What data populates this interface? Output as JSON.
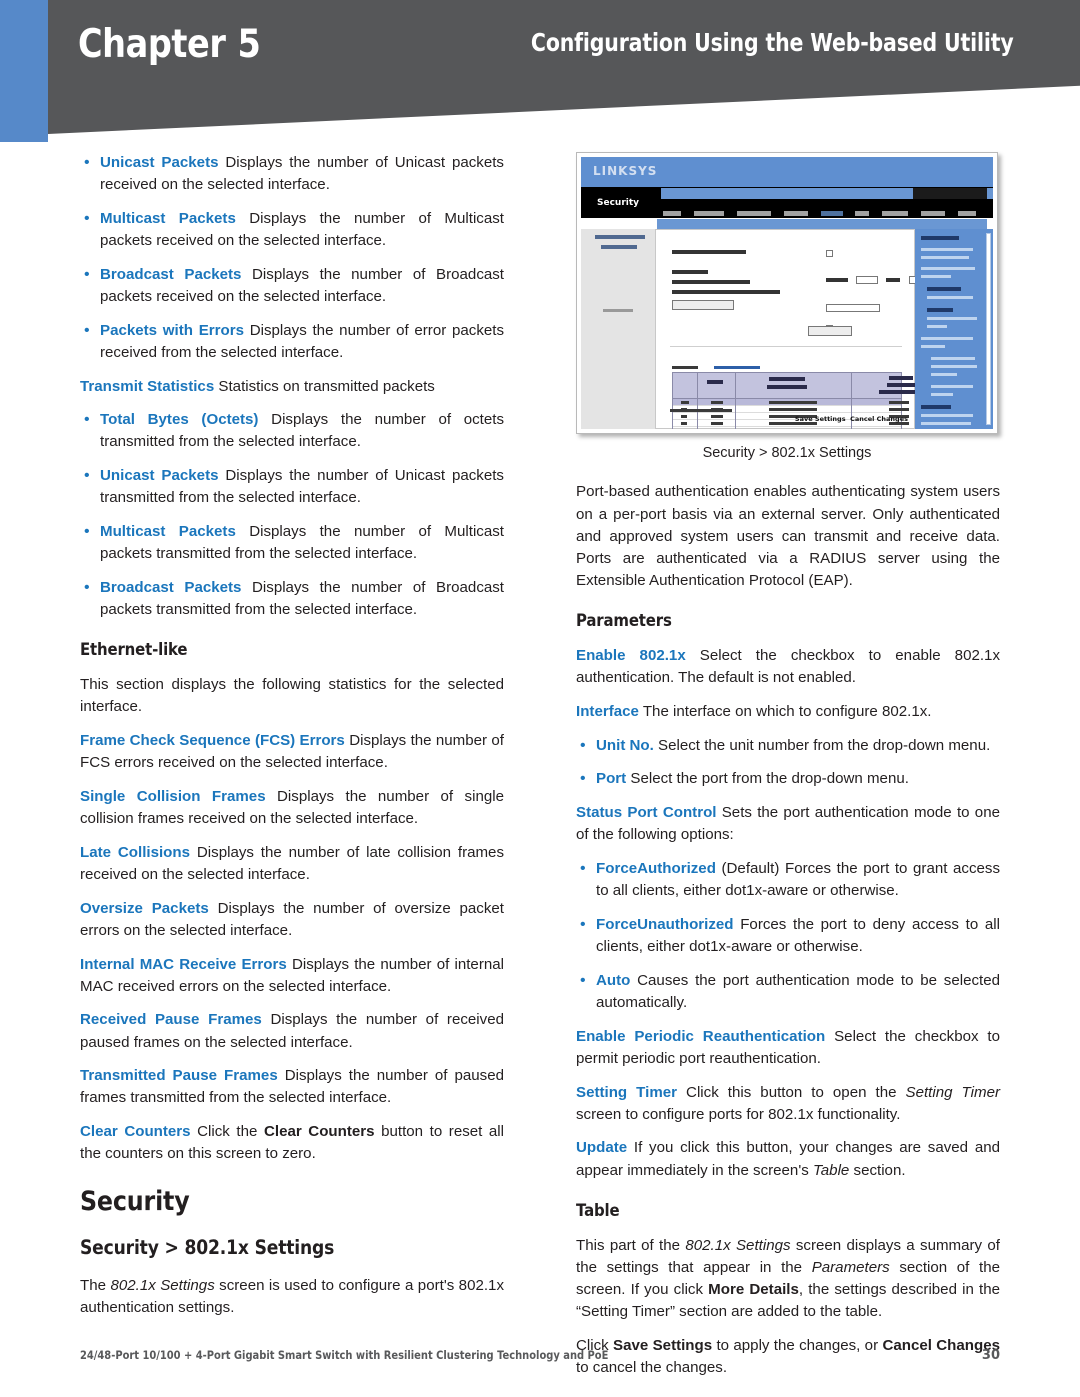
{
  "header": {
    "chapter_word": "Chapter",
    "chapter_number": "5",
    "running_title": "Configuration Using the Web-based Utility",
    "blue_accent": "#5689c9",
    "gray_band": "#565759"
  },
  "theme": {
    "term_blue": "#1b76bc",
    "body_black": "#231f20"
  },
  "left_column": {
    "receive_bullets": [
      {
        "term": "Unicast Packets",
        "text": " Displays the number of Unicast packets received on the selected interface."
      },
      {
        "term": "Multicast Packets",
        "text": "  Displays the number of Multicast packets received on the selected interface."
      },
      {
        "term": "Broadcast Packets",
        "text": "  Displays the number of Broadcast packets received on the selected interface."
      },
      {
        "term": "Packets with Errors",
        "text": " Displays the number of error packets received from the selected interface."
      }
    ],
    "transmit_lead": {
      "term": "Transmit Statistics",
      "text": "  Statistics on transmitted packets"
    },
    "transmit_bullets": [
      {
        "term": "Total Bytes (Octets)",
        "text": "  Displays the number of octets transmitted from the selected interface."
      },
      {
        "term": "Unicast Packets",
        "text": " Displays the number of Unicast packets transmitted from the selected interface."
      },
      {
        "term": "Multicast Packets",
        "text": "  Displays the number of Multicast packets transmitted from the selected interface."
      },
      {
        "term": "Broadcast Packets",
        "text": "  Displays the number of Broadcast packets transmitted from the selected interface."
      }
    ],
    "ethernet_like_heading": "Ethernet-like",
    "ethernet_intro": "This section displays the following statistics for the selected interface.",
    "ethernet_items": [
      {
        "term": "Frame Check Sequence (FCS) Errors",
        "text": " Displays the number of FCS errors received on the selected interface."
      },
      {
        "term": "Single Collision Frames",
        "text": "  Displays the number of single collision frames received on the selected interface."
      },
      {
        "term": "Late Collisions",
        "text": " Displays the number of late collision frames received on the selected interface."
      },
      {
        "term": "Oversize Packets",
        "text": "  Displays the number of oversize packet errors on the selected interface."
      },
      {
        "term": "Internal MAC Receive Errors",
        "text": " Displays the number of internal MAC received errors on the selected interface."
      },
      {
        "term": "Received Pause Frames",
        "text": "  Displays the number of received paused frames on the selected interface."
      },
      {
        "term": "Transmitted Pause Frames",
        "text": " Displays the number of paused frames transmitted from the selected interface."
      }
    ],
    "clear_counters": {
      "term": "Clear Counters",
      "text_before": "  Click the ",
      "button_label": "Clear Counters",
      "text_after": " button to reset all the counters on this screen to zero."
    },
    "security_heading": "Security",
    "security_subheading": "Security > 802.1x Settings",
    "security_intro_before": "The ",
    "security_intro_italic": "802.1x Settings",
    "security_intro_after": " screen is used to configure a port's 802.1x authentication settings."
  },
  "figure": {
    "caption": "Security > 802.1x Settings",
    "screenshot": {
      "brand": "LINKSYS",
      "section_label": "Security",
      "save_settings": "Save Settings",
      "cancel_changes": "Cancel Changes"
    }
  },
  "right_column": {
    "intro": "Port-based authentication enables authenticating system users on a per-port basis via an external server. Only authenticated and approved system users can transmit and receive data. Ports are authenticated via a RADIUS server using the Extensible Authentication Protocol (EAP).",
    "parameters_heading": "Parameters",
    "enable_8021x": {
      "term": "Enable 802.1x",
      "text": " Select the checkbox to enable 802.1x authentication. The default is not enabled."
    },
    "interface": {
      "term": "Interface",
      "text": "  The interface on which to configure 802.1x."
    },
    "interface_bullets": [
      {
        "term": "Unit No.",
        "text": "  Select the unit number from the drop-down menu."
      },
      {
        "term": "Port",
        "text": "  Select the port from the drop-down menu."
      }
    ],
    "status_port_control": {
      "term": "Status Port Control",
      "text": "  Sets the port authentication mode to one of the following options:"
    },
    "status_bullets": [
      {
        "term": "ForceAuthorized",
        "text": "  (Default) Forces the port to grant access to all clients, either dot1x-aware or otherwise."
      },
      {
        "term": "ForceUnauthorized",
        "text": "  Forces the port to deny access to all clients, either dot1x-aware or otherwise."
      },
      {
        "term": "Auto",
        "text": " Causes the port authentication mode to be selected automatically."
      }
    ],
    "enable_periodic": {
      "term": "Enable Periodic Reauthentication",
      "text": "  Select the checkbox to permit periodic port reauthentication."
    },
    "setting_timer": {
      "term": "Setting Timer",
      "text_before": "  Click this button to open the ",
      "italic": "Setting Timer",
      "text_after": " screen to configure ports for 802.1x functionality."
    },
    "update": {
      "term": "Update",
      "text_before": "  If you click this button, your changes are saved and appear immediately in the screen's ",
      "italic": "Table",
      "text_after": " section."
    },
    "table_heading": "Table",
    "table_para": {
      "t1": "This part of the ",
      "i1": "802.1x Settings",
      "t2": " screen displays a summary of the settings that appear in the ",
      "i2": "Parameters",
      "t3": " section of the screen. If you click ",
      "b1": "More Details",
      "t4": ", the settings described in the “Setting Timer” section are added to the table."
    },
    "save_para": {
      "t1": "Click ",
      "b1": "Save Settings",
      "t2": " to apply the changes, or ",
      "b2": "Cancel Changes",
      "t3": " to cancel the changes."
    }
  },
  "footer": {
    "product": "24/48-Port 10/100 + 4-Port Gigabit Smart Switch with Resilient Clustering Technology and PoE",
    "page_number": "30"
  }
}
